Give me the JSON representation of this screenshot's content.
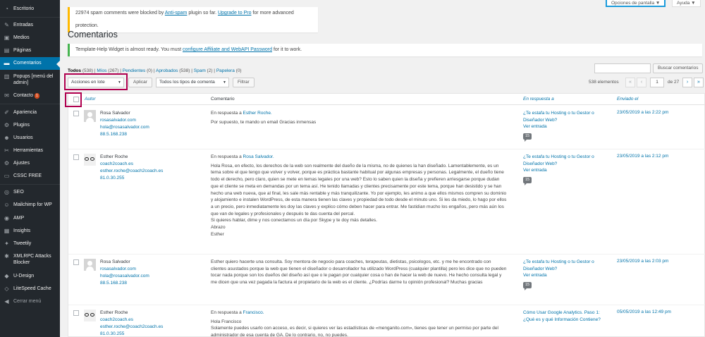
{
  "sidebar": {
    "items": [
      {
        "label": "Escritorio",
        "icon": "dashboard-icon",
        "glyph": "◔"
      },
      {
        "label": "Entradas",
        "icon": "pin-icon",
        "glyph": "✎"
      },
      {
        "label": "Medios",
        "icon": "media-icon",
        "glyph": "▣"
      },
      {
        "label": "Páginas",
        "icon": "pages-icon",
        "glyph": "▤"
      },
      {
        "label": "Comentarios",
        "icon": "comments-icon",
        "glyph": "▬"
      },
      {
        "label": "Popups [menú del admin]",
        "icon": "popup-icon",
        "glyph": "▥"
      },
      {
        "label": "Contacto",
        "icon": "mail-icon",
        "glyph": "✉",
        "badge": "1"
      },
      {
        "label": "Apariencia",
        "icon": "brush-icon",
        "glyph": "✐"
      },
      {
        "label": "Plugins",
        "icon": "plugin-icon",
        "glyph": "⚙"
      },
      {
        "label": "Usuarios",
        "icon": "users-icon",
        "glyph": "☻"
      },
      {
        "label": "Herramientas",
        "icon": "wrench-icon",
        "glyph": "✂"
      },
      {
        "label": "Ajustes",
        "icon": "settings-icon",
        "glyph": "⚙"
      },
      {
        "label": "CSSC FREE",
        "icon": "css-icon",
        "glyph": "▭"
      },
      {
        "label": "SEO",
        "icon": "seo-icon",
        "glyph": "◎"
      },
      {
        "label": "Mailchimp for WP",
        "icon": "mailchimp-icon",
        "glyph": "☺"
      },
      {
        "label": "AMP",
        "icon": "amp-icon",
        "glyph": "◉"
      },
      {
        "label": "Insights",
        "icon": "insights-icon",
        "glyph": "▦"
      },
      {
        "label": "Tweetily",
        "icon": "tweet-icon",
        "glyph": "✦"
      },
      {
        "label": "XMLRPC Attacks Blocker",
        "icon": "shield-icon",
        "glyph": "✱"
      },
      {
        "label": "U-Design",
        "icon": "design-icon",
        "glyph": "◆"
      },
      {
        "label": "LiteSpeed Cache",
        "icon": "litespeed-icon",
        "glyph": "◇"
      },
      {
        "label": "Cerrar menú",
        "icon": "collapse-icon",
        "glyph": "◀"
      }
    ]
  },
  "top": {
    "screen_options": "Opciones de pantalla",
    "help": "Ayuda",
    "accent": "#1a9bdb"
  },
  "notices": {
    "spam_count": "22974 spam comments were blocked by",
    "spam_plugin": "Anti-spam",
    "spam_mid": "plugin so far.",
    "spam_upgrade": "Upgrade to Pro",
    "spam_tail": "for more advanced protection.",
    "widget_text": "Template-Help Widget is almost ready. You must",
    "widget_link": "configure Affiliate and WebAPI Password",
    "widget_tail": "for it to work."
  },
  "page_title": "Comentarios",
  "filters": {
    "todos": "Todos",
    "todos_n": "(538)",
    "mios": "Míos",
    "mios_n": "(267)",
    "pendientes": "Pendientes",
    "pendientes_n": "(0)",
    "aprobados": "Aprobados",
    "aprobados_n": "(538)",
    "spam": "Spam",
    "spam_n": "(2)",
    "papelera": "Papelera",
    "papelera_n": "(0)"
  },
  "search": {
    "button": "Buscar comentarios"
  },
  "bulk": {
    "actions_selected": "Acciones en lote",
    "apply": "Aplicar",
    "type_selected": "Todos los tipos de comenta",
    "filter": "Filtrar"
  },
  "pagination": {
    "count": "538 elementos",
    "first": "«",
    "prev": "‹",
    "current": "1",
    "of": "de 27",
    "next": "›",
    "last": "»"
  },
  "table": {
    "headers": {
      "author": "Autor",
      "comment": "Comentario",
      "response": "En respuesta a",
      "sent": "Enviado el"
    },
    "rows": [
      {
        "avatar": "default",
        "name": "Rosa Salvador",
        "site": "rosasalvador.com",
        "email": "hola@rosasalvador.com",
        "ip": "88.5.168.238",
        "in_reply": "En respuesta a",
        "in_reply_to": "Esther Roche.",
        "text": "Por supuesto, te mando un email Gracias inmensas",
        "post": "¿Te estafa tu Hosting o tu Gestor o Diseñador Web?",
        "ver": "Ver entrada",
        "count": "15",
        "date": "23/05/2019 a las 2:22 pm"
      },
      {
        "avatar": "glasses",
        "name": "Esther Roche",
        "site": "coach2coach.es",
        "email": "esther.roche@coach2coach.es",
        "ip": "81.0.30.255",
        "in_reply": "En respuesta a",
        "in_reply_to": "Rosa Salvador.",
        "text": "Hola Rosa, en efecto, los derechos de la web son realmente del dueño de la misma, no de quienes la han diseñado. Lamentablemente, es un tema sobre el que tengo que volver y volver, porque es práctica bastante habitual por algunas empresas y personas. Legalmente, el dueño tiene todo el derecho, pero claro, quien se mete en temas legales por una web? Esto lo saben quien la diseña y prefieren arriesgarse porque dudan que el cliente se meta en demandas por un tema así. He tenido llamadas y clientes precisamente por este tema, porque han desistido y se han hecho una web nueva, que al final, les sale más rentable y más tranquilizante. Yo por ejemplo, les animo a que ellos mismos compren su dominio y alojamiento e instalen WordPress, de esta manera tienen las claves y propiedad de todo desde el minuto uno. Si les da miedo, lo hago por ellos a un precio, pero inmediatamente les doy las claves y explico cómo deben hacer para entrar. Me fastidian mucho los engaños, pero más aún los que van de legales y profesionales y después te das cuenta del percal.",
        "text2": "Si quieres hablar, dime y nos conectamos un día por Skype y te doy más detalles.",
        "text3": "Abrazo",
        "text4": "Esther",
        "post": "¿Te estafa tu Hosting o tu Gestor o Diseñador Web?",
        "ver": "Ver entrada",
        "count": "15",
        "date": "23/05/2019 a las 2:12 pm"
      },
      {
        "avatar": "default",
        "name": "Rosa Salvador",
        "site": "rosasalvador.com",
        "email": "hola@rosasalvador.com",
        "ip": "88.5.168.238",
        "text": "Esther quiero hacerte una consulta. Soy mentora de negocio para coaches, terapeutas, dietistas, psicologos, etc. y me he encontrado con clientes asustados porque la web que tienen el diseñador o desarrollador ha utilizado WordPress (cualquier plantilla) pero les dice que no pueden tocar nada porque son los dueños del diseño así que o le pagan por cualquier cosa o han de hacer la web de nuevo. He hecho consulta legal y me dicen que una vez pagada la factura el propietario de la web es el cliente. ¿Podrías darme tu opinión profesional? Muchas gracias",
        "post": "¿Te estafa tu Hosting o tu Gestor o Diseñador Web?",
        "ver": "Ver entrada",
        "count": "15",
        "date": "23/05/2019 a las 2:03 pm"
      },
      {
        "avatar": "glasses",
        "name": "Esther Roche",
        "site": "coach2coach.es",
        "email": "esther.roche@coach2coach.es",
        "ip": "81.0.30.255",
        "in_reply": "En respuesta a",
        "in_reply_to": "Francisco.",
        "text": "Hola Francisco",
        "text2": "Solamente puedes usarlo con acceso, es decir, si quieres ver las estadísticas de «menganito.com», tienes que tener un permiso por parte del administrador de esa cuenta de GA. De lo contrario, no, no puedes.",
        "post": "Cómo Usar Google Analytics. Paso 1: ¿Qué es y qué Información Contiene?",
        "date": "05/05/2019 a las 12:49 pm"
      }
    ]
  }
}
